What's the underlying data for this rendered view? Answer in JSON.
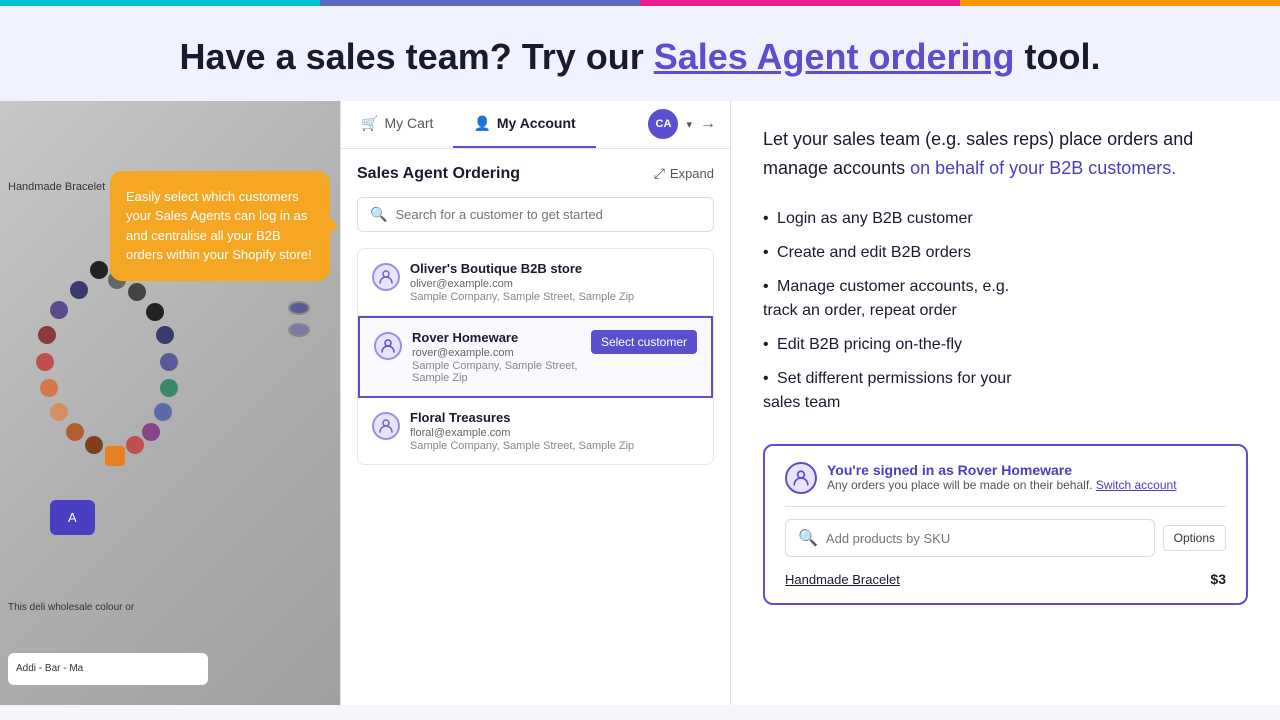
{
  "topBar": {},
  "header": {
    "title_plain": "Have a sales team? Try our ",
    "title_link": "Sales Agent ordering",
    "title_end": " tool."
  },
  "nav": {
    "cart_label": "My Cart",
    "account_label": "My Account",
    "avatar_initials": "CA"
  },
  "panel": {
    "title": "Sales Agent Ordering",
    "expand_label": "Expand",
    "search_placeholder": "Search for a customer to get started",
    "customers": [
      {
        "name": "Oliver's Boutique B2B store",
        "email": "oliver@example.com",
        "company": "Sample Company, Sample Street, Sample Zip",
        "selected": false
      },
      {
        "name": "Rover Homeware",
        "email": "rover@example.com",
        "company": "Sample Company, Sample Street, Sample Zip",
        "selected": true
      },
      {
        "name": "Floral Treasures",
        "email": "floral@example.com",
        "company": "Sample Company, Sample Street, Sample Zip",
        "selected": false
      }
    ],
    "select_customer_btn": "Select customer"
  },
  "tooltip": {
    "text": "Easily select which customers your Sales Agents can log in as and centralise all your B2B orders within your Shopify store!"
  },
  "features": {
    "intro": "Let your sales team (e.g. sales reps) place orders and manage accounts ",
    "intro_link": "on behalf of your B2B customers.",
    "list": [
      "Login as any B2B customer",
      "Create and edit B2B orders",
      "Manage customer accounts, e.g. track an order, repeat order",
      "Edit B2B pricing on-the-fly",
      "Set different permissions for your sales team"
    ]
  },
  "signedInCard": {
    "title": "You're signed in as Rover Homeware",
    "subtitle": "Any orders you place will be made on their behalf.",
    "switch_label": "Switch account",
    "sku_placeholder": "Add products by SKU",
    "options_label": "Options",
    "product_name": "Handmade Bracelet",
    "product_price": "$3"
  },
  "product": {
    "label": "Handmade Bracelet",
    "desc": "This deli wholesale colour or",
    "additional": "Addi\n- Bar\n- Ma"
  }
}
